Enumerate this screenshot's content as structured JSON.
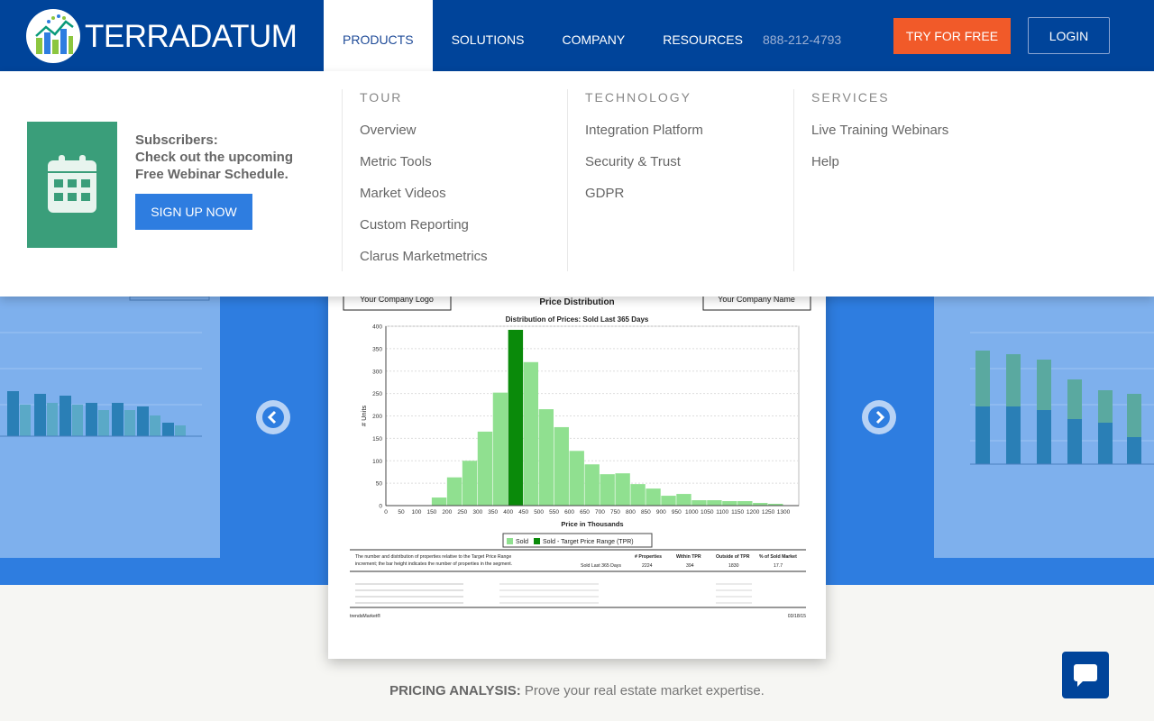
{
  "header": {
    "logo_text": "TERRADATUM",
    "nav": [
      {
        "label": "PRODUCTS",
        "active": true
      },
      {
        "label": "SOLUTIONS"
      },
      {
        "label": "COMPANY"
      },
      {
        "label": "RESOURCES"
      }
    ],
    "phone": "888-212-4793",
    "try_label": "TRY FOR FREE",
    "login_label": "LOGIN"
  },
  "dropdown": {
    "promo": {
      "line1": "Subscribers:",
      "line2": "Check out the upcoming",
      "line3": "Free Webinar Schedule.",
      "button": "SIGN UP NOW",
      "icon": "calendar-icon"
    },
    "columns": [
      {
        "title": "TOUR",
        "links": [
          "Overview",
          "Metric Tools",
          "Market Videos",
          "Custom Reporting",
          "Clarus Marketmetrics"
        ]
      },
      {
        "title": "TECHNOLOGY",
        "links": [
          "Integration Platform",
          "Security & Trust",
          "GDPR"
        ]
      },
      {
        "title": "SERVICES",
        "links": [
          "Live Training Webinars",
          "Help"
        ]
      }
    ]
  },
  "card": {
    "logo_box": "Your Company Logo",
    "name_box": "Your Company Name",
    "title": "Price Distribution",
    "chart_data": {
      "type": "bar",
      "title": "Distribution of Prices: Sold Last 365 Days",
      "xlabel": "Price in Thousands",
      "ylabel": "# Units",
      "ylim": [
        0,
        400
      ],
      "yticks": [
        0,
        50,
        100,
        150,
        200,
        250,
        300,
        350,
        400
      ],
      "xticks": [
        0,
        50,
        100,
        150,
        200,
        250,
        300,
        350,
        400,
        450,
        500,
        550,
        600,
        650,
        700,
        750,
        800,
        850,
        900,
        950,
        1000,
        1050,
        1100,
        1150,
        1200,
        1250,
        1300
      ],
      "series": [
        {
          "name": "Sold",
          "color": "#90e090",
          "x": [
            150,
            200,
            250,
            300,
            350,
            400,
            450,
            500,
            550,
            600,
            650,
            700,
            750,
            800,
            850,
            900,
            950,
            1000,
            1050,
            1100,
            1150,
            1200,
            1250
          ],
          "values": [
            18,
            63,
            100,
            165,
            252,
            392,
            320,
            215,
            175,
            122,
            92,
            70,
            72,
            48,
            38,
            22,
            26,
            12,
            12,
            10,
            10,
            6,
            4
          ]
        },
        {
          "name": "Sold - Target Price Range (TPR)",
          "color": "#0a8a0a",
          "x": [
            400
          ],
          "values": [
            392
          ]
        }
      ],
      "legend": "bottom",
      "grid": true
    },
    "summary_text": "The number and distribution of properties relative to the Target Price Range increment; the bar height indicates the number of properties in the segment.",
    "summary_headers": [
      "# Properties",
      "Within TPR",
      "Outside of TPR",
      "% of Sold Market"
    ],
    "summary_row": [
      "Sold Last 365 Days",
      "2224",
      "394",
      "1830",
      "17.7"
    ],
    "footer_left": "trendsMarket®",
    "footer_right": "03/18/15"
  },
  "caption": {
    "bold": "PRICING ANALYSIS:",
    "text": " Prove your real estate market expertise."
  }
}
